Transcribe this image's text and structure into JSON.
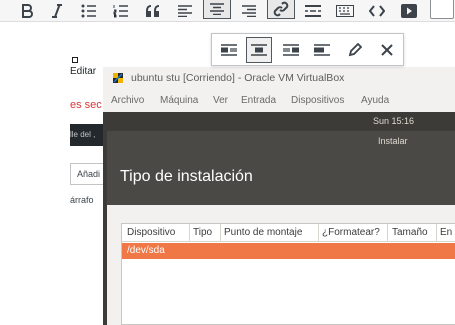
{
  "toolbar": {
    "buttons": [
      {
        "name": "bold-icon",
        "icon": "bold"
      },
      {
        "name": "italic-icon",
        "icon": "italic"
      },
      {
        "name": "bulleted-list-icon",
        "icon": "bulleted-list"
      },
      {
        "name": "numbered-list-icon",
        "icon": "numbered-list"
      },
      {
        "name": "blockquote-icon",
        "icon": "blockquote"
      },
      {
        "name": "align-left-icon",
        "icon": "align-left"
      },
      {
        "name": "align-center-icon",
        "icon": "align-center",
        "active": true
      },
      {
        "name": "align-right-icon",
        "icon": "align-right"
      },
      {
        "name": "link-icon",
        "icon": "link",
        "active": true
      },
      {
        "name": "read-more-icon",
        "icon": "read-more"
      },
      {
        "name": "keyboard-icon",
        "icon": "keyboard"
      },
      {
        "name": "code-icon",
        "icon": "code"
      },
      {
        "name": "media-icon",
        "icon": "play"
      }
    ]
  },
  "image_toolbar": {
    "buttons": [
      {
        "name": "align-image-left-icon"
      },
      {
        "name": "align-image-center-icon",
        "active": true
      },
      {
        "name": "align-image-right-icon"
      },
      {
        "name": "align-image-none-icon"
      },
      {
        "name": "edit-image-icon"
      },
      {
        "name": "remove-image-icon"
      }
    ]
  },
  "left_column": {
    "editar": "Editar",
    "red_text": "es sec",
    "dark_bar": "lle del ,",
    "anadir": "Añadi",
    "parrafo": "árrafo"
  },
  "vbox": {
    "title": "ubuntu stu [Corriendo] - Oracle VM VirtualBox",
    "menu": [
      "Archivo",
      "Máquina",
      "Ver",
      "Entrada",
      "Dispositivos",
      "Ayuda"
    ],
    "clock": "Sun 15:16",
    "installer_label": "Instalar",
    "heading": "Tipo de instalación",
    "columns": [
      "Dispositivo",
      "Tipo",
      "Punto de montaje",
      "¿Formatear?",
      "Tamaño",
      "En u"
    ],
    "rows": [
      "/dev/sda"
    ]
  },
  "colors": {
    "accent_orange": "#f07746",
    "ubuntu_dark": "#3c3b37",
    "red_text": "#d63638"
  }
}
